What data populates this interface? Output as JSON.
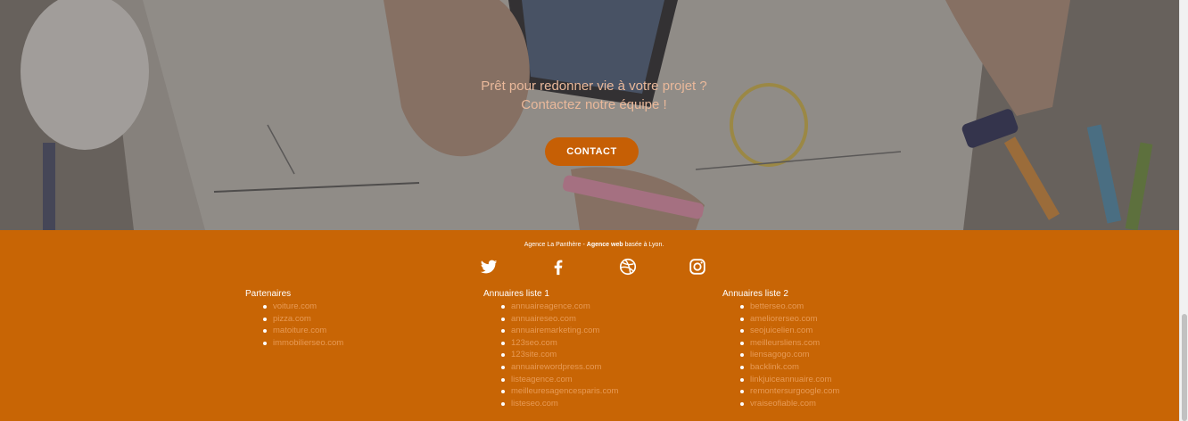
{
  "hero": {
    "tagline_line1": "Prêt pour redonner vie à votre projet ?",
    "tagline_line2": "Contactez notre équipe !",
    "cta_label": "CONTACT"
  },
  "footer": {
    "agency_name": "Agence La Panthère",
    "agency_sep": " - ",
    "agency_strong": "Agence web",
    "agency_rest": " basée à Lyon.",
    "socials": [
      {
        "name": "twitter-icon"
      },
      {
        "name": "facebook-icon"
      },
      {
        "name": "dribbble-icon"
      },
      {
        "name": "instagram-icon"
      }
    ],
    "columns": [
      {
        "title": "Partenaires",
        "items": [
          "voiture.com",
          "pizza.com",
          "matoiture.com",
          "immobilierseo.com"
        ]
      },
      {
        "title": "Annuaires liste 1",
        "items": [
          "annuaireagence.com",
          "annuaireseo.com",
          "annuairemarketing.com",
          "123seo.com",
          "123site.com",
          "annuairewordpress.com",
          "listeagence.com",
          "meilleuresagencesparis.com",
          "listeseo.com"
        ]
      },
      {
        "title": "Annuaires liste 2",
        "items": [
          "betterseo.com",
          "ameliorerseo.com",
          "seojuicelien.com",
          "meilleursliens.com",
          "liensagogo.com",
          "backlink.com",
          "linkjuiceannuaire.com",
          "remontersurgoogle.com",
          "vraiseofiable.com"
        ]
      }
    ]
  },
  "colors": {
    "brand_orange": "#c86505",
    "cta_orange": "#c65f05",
    "link_orange": "#e79a55"
  }
}
